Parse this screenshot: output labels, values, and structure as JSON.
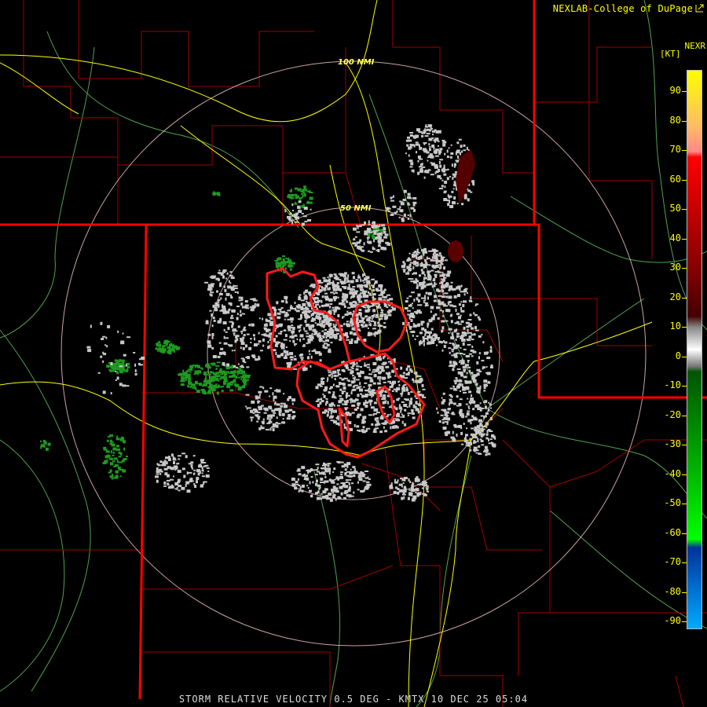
{
  "credit": "NEXLAB-College of DuPage",
  "credit_icon": "external-link-icon",
  "product_label": "NEXR",
  "unit_label": "[KT]",
  "range_rings": [
    {
      "label": "100 NMI"
    },
    {
      "label": "50 NMI"
    }
  ],
  "colorbar": {
    "ticks": [
      "90",
      "80",
      "70",
      "60",
      "50",
      "40",
      "30",
      "20",
      "10",
      "0",
      "-10",
      "-20",
      "-30",
      "-40",
      "-50",
      "-60",
      "-70",
      "-80",
      "-90"
    ],
    "stops": [
      {
        "value": 100,
        "color": "#ffff00"
      },
      {
        "value": 80,
        "color": "#ffbb66"
      },
      {
        "value": 71,
        "color": "#ff8888"
      },
      {
        "value": 69,
        "color": "#ff0000"
      },
      {
        "value": 30,
        "color": "#880000"
      },
      {
        "value": 12,
        "color": "#440000"
      },
      {
        "value": 8,
        "color": "#888888"
      },
      {
        "value": 0,
        "color": "#ffffff"
      },
      {
        "value": -6,
        "color": "#777777"
      },
      {
        "value": -8,
        "color": "#005500"
      },
      {
        "value": -40,
        "color": "#00aa00"
      },
      {
        "value": -68,
        "color": "#00ff00"
      },
      {
        "value": -71,
        "color": "#003399"
      },
      {
        "value": -100,
        "color": "#00aaff"
      }
    ]
  },
  "colors": {
    "state_border": "#ff0000",
    "county_border": "#aa0000",
    "highway": "#ffff00",
    "river": "#66cc66",
    "ring": "#ffcccc",
    "warning_polygon": "#ff1a1a",
    "echo_gray": "#cccccc",
    "echo_green": "#22aa22"
  },
  "footer": "STORM RELATIVE VELOCITY 0.5 DEG - KMTX 10 DEC 25 05:04"
}
